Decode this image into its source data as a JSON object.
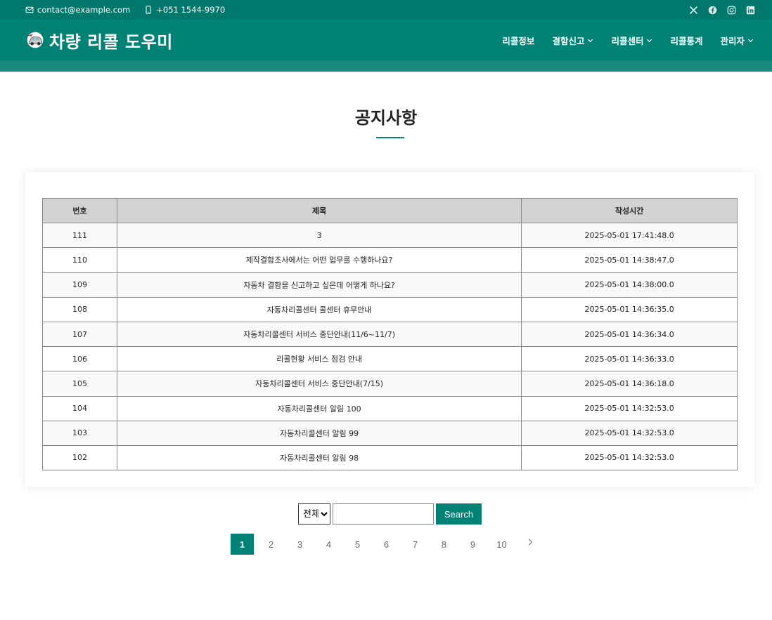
{
  "topbar": {
    "email": "contact@example.com",
    "phone": "+051 1544-9970",
    "social_icons": [
      "x-icon",
      "facebook-icon",
      "instagram-icon",
      "linkedin-icon"
    ]
  },
  "brand": {
    "name": "차량 리콜 도우미",
    "logo_icon": "car-logo-icon"
  },
  "nav": {
    "items": [
      {
        "label": "리콜정보",
        "dropdown": false
      },
      {
        "label": "결함신고",
        "dropdown": true
      },
      {
        "label": "리콜센터",
        "dropdown": true
      },
      {
        "label": "리콜통계",
        "dropdown": false
      },
      {
        "label": "관리자",
        "dropdown": true
      }
    ]
  },
  "page": {
    "title": "공지사항"
  },
  "table": {
    "headers": [
      "번호",
      "제목",
      "작성시간"
    ],
    "rows": [
      {
        "num": "111",
        "title": "3",
        "time": "2025-05-01 17:41:48.0"
      },
      {
        "num": "110",
        "title": "제작결함조사에서는 어떤 업무를 수행하나요?",
        "time": "2025-05-01 14:38:47.0"
      },
      {
        "num": "109",
        "title": "자동차 결함을 신고하고 싶은데 어떻게 하나요?",
        "time": "2025-05-01 14:38:00.0"
      },
      {
        "num": "108",
        "title": "자동차리콜센터 콜센터 휴무안내",
        "time": "2025-05-01 14:36:35.0"
      },
      {
        "num": "107",
        "title": "자동차리콜센터 서비스 중단안내(11/6~11/7)",
        "time": "2025-05-01 14:36:34.0"
      },
      {
        "num": "106",
        "title": "리콜현황 서비스 점검 안내",
        "time": "2025-05-01 14:36:33.0"
      },
      {
        "num": "105",
        "title": "자동차리콜센터 서비스 중단안내(7/15)",
        "time": "2025-05-01 14:36:18.0"
      },
      {
        "num": "104",
        "title": "자동차리콜센터 알림 100",
        "time": "2025-05-01 14:32:53.0"
      },
      {
        "num": "103",
        "title": "자동차리콜센터 알림 99",
        "time": "2025-05-01 14:32:53.0"
      },
      {
        "num": "102",
        "title": "자동차리콜센터 알림 98",
        "time": "2025-05-01 14:32:53.0"
      }
    ]
  },
  "search": {
    "select_value": "전체",
    "input_value": "",
    "button_label": "Search"
  },
  "pagination": {
    "pages": [
      "1",
      "2",
      "3",
      "4",
      "5",
      "6",
      "7",
      "8",
      "9",
      "10"
    ],
    "current": "1"
  },
  "colors": {
    "topbar": "#00786b",
    "header": "#008374",
    "accent": "#008374",
    "table_header": "#d3d3d3"
  }
}
